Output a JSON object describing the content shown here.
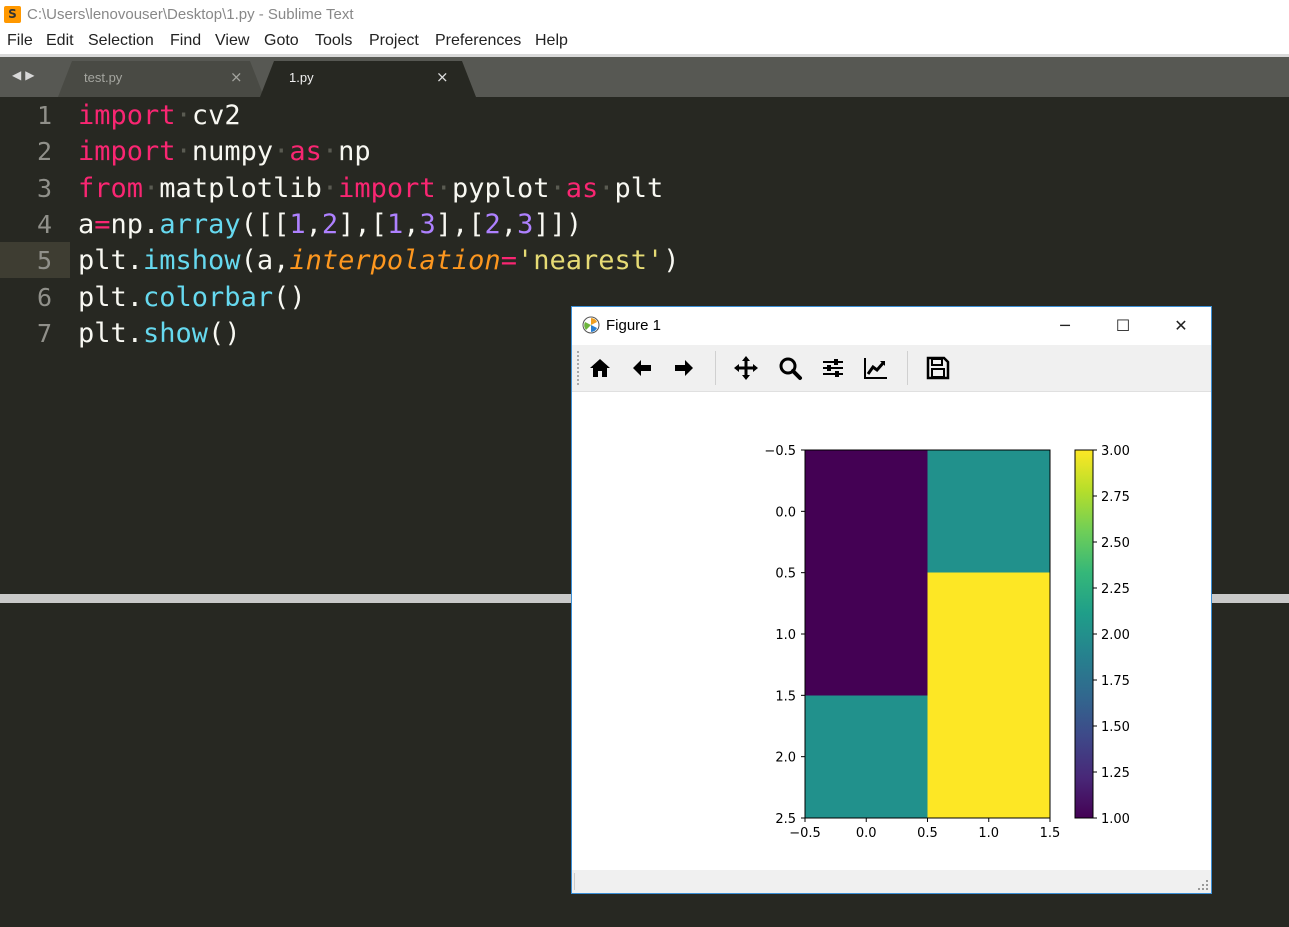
{
  "window": {
    "title": "C:\\Users\\lenovouser\\Desktop\\1.py - Sublime Text",
    "app_icon_glyph": "S"
  },
  "menu": [
    "File",
    "Edit",
    "Selection",
    "Find",
    "View",
    "Goto",
    "Tools",
    "Project",
    "Preferences",
    "Help"
  ],
  "tabs": [
    {
      "label": "test.py",
      "active": false,
      "close": "×"
    },
    {
      "label": "1.py",
      "active": true,
      "close": "×"
    }
  ],
  "nav_arrows": "◀▶",
  "code_lines": [
    {
      "num": "1",
      "tokens": [
        {
          "t": "import",
          "c": "kw"
        },
        {
          "t": "·",
          "c": "ws"
        },
        {
          "t": "cv2",
          "c": ""
        }
      ]
    },
    {
      "num": "2",
      "tokens": [
        {
          "t": "import",
          "c": "kw"
        },
        {
          "t": "·",
          "c": "ws"
        },
        {
          "t": "numpy",
          "c": ""
        },
        {
          "t": "·",
          "c": "ws"
        },
        {
          "t": "as",
          "c": "kw"
        },
        {
          "t": "·",
          "c": "ws"
        },
        {
          "t": "np",
          "c": ""
        }
      ]
    },
    {
      "num": "3",
      "tokens": [
        {
          "t": "from",
          "c": "kw"
        },
        {
          "t": "·",
          "c": "ws"
        },
        {
          "t": "matplotlib",
          "c": ""
        },
        {
          "t": "·",
          "c": "ws"
        },
        {
          "t": "import",
          "c": "kw"
        },
        {
          "t": "·",
          "c": "ws"
        },
        {
          "t": "pyplot",
          "c": ""
        },
        {
          "t": "·",
          "c": "ws"
        },
        {
          "t": "as",
          "c": "kw"
        },
        {
          "t": "·",
          "c": "ws"
        },
        {
          "t": "plt",
          "c": ""
        }
      ]
    },
    {
      "num": "4",
      "tokens": [
        {
          "t": "a",
          "c": ""
        },
        {
          "t": "=",
          "c": "kw"
        },
        {
          "t": "np.",
          "c": ""
        },
        {
          "t": "array",
          "c": "fn"
        },
        {
          "t": "([[",
          "c": ""
        },
        {
          "t": "1",
          "c": "num"
        },
        {
          "t": ",",
          "c": ""
        },
        {
          "t": "2",
          "c": "num"
        },
        {
          "t": "],[",
          "c": ""
        },
        {
          "t": "1",
          "c": "num"
        },
        {
          "t": ",",
          "c": ""
        },
        {
          "t": "3",
          "c": "num"
        },
        {
          "t": "],[",
          "c": ""
        },
        {
          "t": "2",
          "c": "num"
        },
        {
          "t": ",",
          "c": ""
        },
        {
          "t": "3",
          "c": "num"
        },
        {
          "t": "]])",
          "c": ""
        }
      ]
    },
    {
      "num": "5",
      "current": true,
      "tokens": [
        {
          "t": "plt.",
          "c": ""
        },
        {
          "t": "imshow",
          "c": "fn"
        },
        {
          "t": "(a,",
          "c": ""
        },
        {
          "t": "interpolation",
          "c": "param"
        },
        {
          "t": "=",
          "c": "kw"
        },
        {
          "t": "'nearest'",
          "c": "str"
        },
        {
          "t": ")",
          "c": ""
        }
      ]
    },
    {
      "num": "6",
      "tokens": [
        {
          "t": "plt.",
          "c": ""
        },
        {
          "t": "colorbar",
          "c": "fn"
        },
        {
          "t": "()",
          "c": ""
        }
      ]
    },
    {
      "num": "7",
      "tokens": [
        {
          "t": "plt.",
          "c": ""
        },
        {
          "t": "show",
          "c": "fn"
        },
        {
          "t": "()",
          "c": ""
        }
      ]
    }
  ],
  "figure": {
    "title": "Figure 1",
    "win_minimize": "─",
    "win_maximize": "☐",
    "win_close": "✕",
    "toolbar_icons": [
      "home-icon",
      "back-arrow-icon",
      "forward-arrow-icon",
      "pan-icon",
      "zoom-icon",
      "subplots-icon",
      "edit-axes-icon",
      "save-icon"
    ]
  },
  "colors": {
    "editor_bg": "#272822",
    "keyword": "#f92672",
    "function": "#66d9ef",
    "number": "#ae81ff",
    "string": "#e6db74",
    "param": "#fd971f"
  },
  "chart_data": {
    "type": "heatmap",
    "matrix": [
      [
        1,
        2
      ],
      [
        1,
        3
      ],
      [
        2,
        3
      ]
    ],
    "cell_colors": {
      "1": "#440154",
      "2": "#21918c",
      "3": "#fde725"
    },
    "x_ticks": [
      "−0.5",
      "0.0",
      "0.5",
      "1.0",
      "1.5"
    ],
    "y_ticks": [
      "−0.5",
      "0.0",
      "0.5",
      "1.0",
      "1.5",
      "2.0",
      "2.5"
    ],
    "xlim": [
      -0.5,
      1.5
    ],
    "ylim": [
      2.5,
      -0.5
    ],
    "colorbar": {
      "range": [
        1.0,
        3.0
      ],
      "ticks": [
        "1.00",
        "1.25",
        "1.50",
        "1.75",
        "2.00",
        "2.25",
        "2.50",
        "2.75",
        "3.00"
      ],
      "colormap": "viridis"
    }
  }
}
